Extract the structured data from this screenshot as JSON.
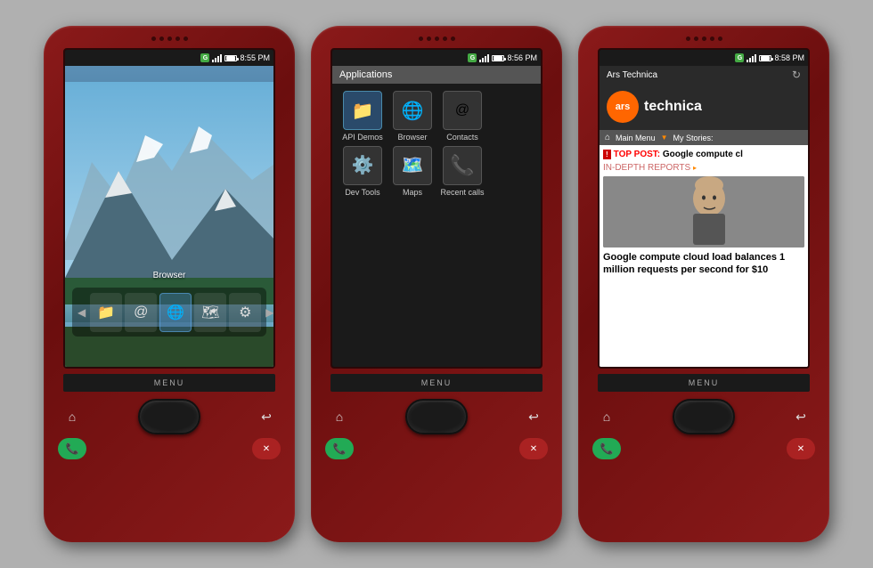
{
  "phones": [
    {
      "id": "phone1",
      "screen": "home",
      "status": {
        "time": "8:55 PM",
        "battery": true,
        "signal": true
      },
      "dock": {
        "label": "Browser",
        "items": [
          "folder",
          "at",
          "globe",
          "map",
          "gear"
        ]
      },
      "menu_label": "MENU"
    },
    {
      "id": "phone2",
      "screen": "applications",
      "status": {
        "time": "8:56 PM",
        "battery": true,
        "signal": true
      },
      "app_title": "Applications",
      "apps": [
        {
          "label": "API Demos",
          "icon": "📁"
        },
        {
          "label": "Browser",
          "icon": "🌐"
        },
        {
          "label": "Contacts",
          "icon": "📧"
        },
        {
          "label": "Dev Tools",
          "icon": "⚙️"
        },
        {
          "label": "Maps",
          "icon": "🗺️"
        },
        {
          "label": "Recent calls",
          "icon": "📞"
        }
      ],
      "menu_label": "MENU"
    },
    {
      "id": "phone3",
      "screen": "browser",
      "status": {
        "time": "8:58 PM",
        "battery": true,
        "signal": true
      },
      "browser": {
        "title": "Ars Technica",
        "site_name": "technica",
        "site_logo": "ars",
        "nav_items": [
          "Main Menu",
          "My Stories:"
        ],
        "top_post_label": "TOP POST:",
        "top_post_text": "Google compute cl",
        "in_depth": "IN-DEPTH REPORTS",
        "article_title": "Google compute cloud load balances 1 million requests per second for $10"
      },
      "menu_label": "MENU"
    }
  ],
  "nav": {
    "home_icon": "⌂",
    "back_icon": "↩",
    "call_icon": "📞",
    "end_icon": "📵"
  }
}
